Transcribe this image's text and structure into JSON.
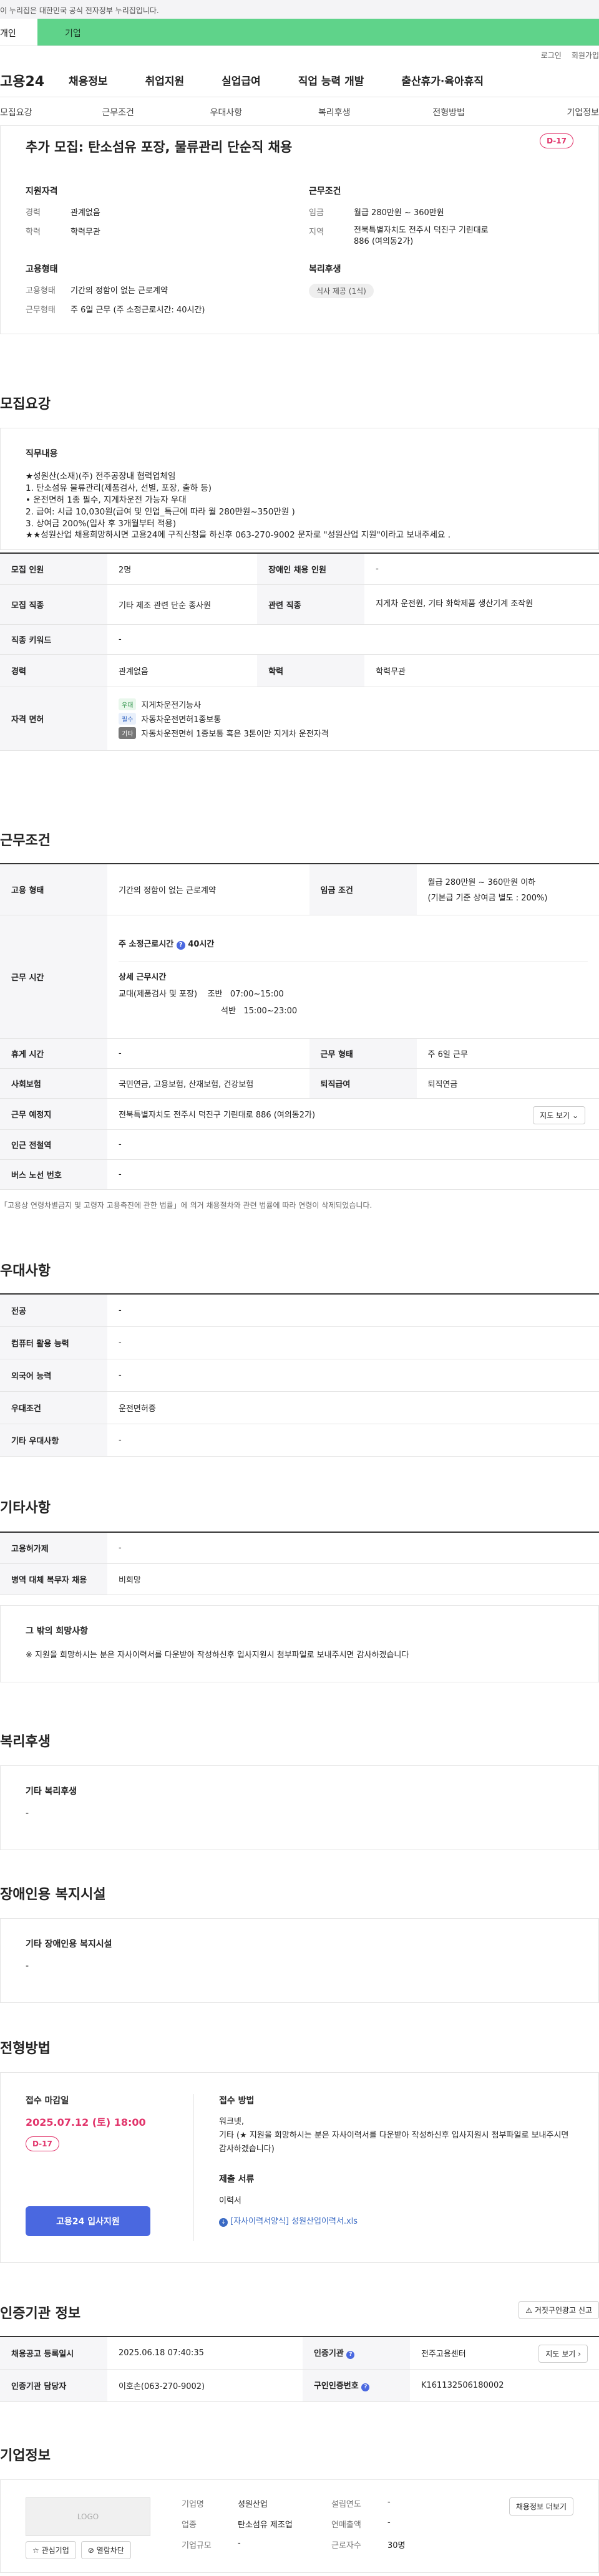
{
  "gov_notice": "이 누리집은 대한민국 공식 전자정부 누리집입니다.",
  "roles": {
    "personal": "개인",
    "company": "기업"
  },
  "util": {
    "login": "로그인",
    "join": "회원가입"
  },
  "gnb": {
    "logo": "고용24",
    "menu": [
      "채용정보",
      "취업지원",
      "실업급여",
      "직업 능력 개발",
      "출산휴가·육아휴직"
    ]
  },
  "tabs": [
    "모집요강",
    "근무조건",
    "우대사항",
    "복리후생",
    "전형방법",
    "기업정보"
  ],
  "head": {
    "title": "추가 모집: 탄소섬유 포장, 물류관리 단순직 채용",
    "dday": "D-17",
    "qual_title": "지원자격",
    "career_k": "경력",
    "career_v": "관계없음",
    "edu_k": "학력",
    "edu_v": "학력무관",
    "cond_title": "근무조건",
    "wage_k": "임금",
    "wage_v": "월급 280만원 ~ 360만원",
    "region_k": "지역",
    "region_v": "전북특별자치도 전주시 덕진구 기린대로 886 (여의동2가)",
    "emp_title": "고용형태",
    "emptype_k": "고용형태",
    "emptype_v": "기간의 정함이 없는 근로계약",
    "worksys_k": "근무형태",
    "worksys_v": "주 6일 근무 (주 소정근로시간: 40시간)",
    "welfare_title": "복리후생",
    "welfare_chip": "식사 제공 (1식)"
  },
  "recruit": {
    "title": "모집요강",
    "duty_title": "직무내용",
    "duty_text": "★성원산(소재)(주) 전주공장내 협력업체임\n1. 탄소섬유  물류관리(제품검사, 선별, 포장, 출하 등)\n• 운전면허 1종 필수,  지게차운전 가능자 우대\n2. 급여: 시급 10,030원(급여 및 인업_특근에 따라 월 280만원~350만원 )\n3. 상여금 200%(입사 후 3개월부터 적용)\n★★성원산업 채용희망하시면 고용24에 구직신청을 하신후   063-270-9002 문자로 \"성원산업 지원\"이라고 보내주세요 .",
    "rows": [
      {
        "k1": "모집 인원",
        "v1": "2명",
        "k2": "장애인 채용 인원",
        "v2": "-"
      },
      {
        "k1": "모집 직종",
        "v1": "기타 제조 관련 단순 종사원",
        "k2": "관련 직종",
        "v2": "지게차 운전원, 기타 화학제품 생산기계 조작원"
      },
      {
        "k1": "직종 키워드",
        "v1": "-"
      },
      {
        "k1": "경력",
        "v1": "관계없음",
        "k2": "학력",
        "v2": "학력무관"
      }
    ],
    "lic_k": "자격 면허",
    "lics": [
      {
        "tag": "우대",
        "name": "지게차운전기능사"
      },
      {
        "tag": "필수",
        "name": "자동차운전면허1종보통"
      },
      {
        "tag": "기타",
        "name": "자동차운전면허 1종보통 혹은 3톤이만 지게차 운전자격"
      }
    ]
  },
  "cond": {
    "title": "근무조건",
    "emp_k": "고용 형태",
    "emp_v": "기간의 정함이 없는 근로계약",
    "wage_k": "임금 조건",
    "wage_v": "월급 280만원 ~ 360만원 이하",
    "wage_sub": "(기본급 기준 상여금 별도 : 200%)",
    "time_k": "근무 시간",
    "std_hours": "주 소정근로시간",
    "std_hours_v": "40시간",
    "detail_title": "상세 근무시간",
    "detail_type": "교대(제품검사 및 포장)",
    "shift1_k": "조반",
    "shift1_v": "07:00~15:00",
    "shift2_k": "석반",
    "shift2_v": "15:00~23:00",
    "rest_k": "휴게 시간",
    "rest_v": "-",
    "form_k": "근무 형태",
    "form_v": "주 6일 근무",
    "ins_k": "사회보험",
    "ins_v": "국민연금, 고용보험, 산재보험, 건강보험",
    "ret_k": "퇴직급여",
    "ret_v": "퇴직연금",
    "loc_k": "근무 예정지",
    "loc_v": "전북특별자치도 전주시 덕진구 기린대로 886 (여의동2가)",
    "map_btn": "지도 보기",
    "station_k": "인근 전철역",
    "station_v": "-",
    "bus_k": "버스 노선 번호",
    "bus_v": "-",
    "footnote": "「고용상 연령차별금지 및 고령자 고용촉진에 관한 법률」에 의거 채용절차와 관련 법률에 따라 연령이 삭제되었습니다."
  },
  "pref": {
    "title": "우대사항",
    "rows": [
      {
        "k": "전공",
        "v": "-"
      },
      {
        "k": "컴퓨터 활용 능력",
        "v": "-"
      },
      {
        "k": "외국어 능력",
        "v": "-"
      },
      {
        "k": "우대조건",
        "v": "운전면허증"
      },
      {
        "k": "기타 우대사항",
        "v": "-"
      }
    ]
  },
  "etc": {
    "title": "기타사항",
    "rows": [
      {
        "k": "고용허가제",
        "v": "-"
      },
      {
        "k": "병역 대체 복무자 채용",
        "v": "비희망"
      }
    ],
    "other_title": "그 밖의 희망사항",
    "other_text": "※ 지원을 희망하시는 분은 자사이력서를 다운받아 작성하신후 입사지원시 첨부파일로 보내주시면 감사하겠습니다"
  },
  "welfare": {
    "title": "복리후생",
    "sub": "기타 복리후생",
    "v": "-"
  },
  "disab": {
    "title": "장애인용 복지시설",
    "sub": "기타 장애인용 복지시설",
    "v": "-"
  },
  "method": {
    "title": "전형방법",
    "deadline_title": "접수 마감일",
    "deadline": "2025.07.12 (토) 18:00",
    "dday": "D-17",
    "apply_btn": "고용24 입사지원",
    "how_title": "접수 방법",
    "how_text": "워크넷,\n기타 (★ 지원을 희망하시는 분은 자사이력서를 다운받아 작성하신후 입사지원시 첨부파일로 보내주시면 감사하겠습니다)",
    "docs_title": "제출 서류",
    "docs_v": "이력서",
    "file": "[자사이력서양식] 성원산업이력서.xls"
  },
  "agency": {
    "title": "인증기관 정보",
    "report_btn": "거짓구인광고 신고",
    "reg_k": "채용공고 등록일시",
    "reg_v": "2025.06.18 07:40:35",
    "org_k": "인증기관",
    "org_v": "전주고용센터",
    "more_btn": "지도 보기",
    "mgr_k": "인증기관 담당자",
    "mgr_v": "이호손(063-270-9002)",
    "no_k": "구인인증번호",
    "no_v": "K161132506180002"
  },
  "company": {
    "title": "기업정보",
    "logo": "LOGO",
    "fav_btn": "관심기업",
    "block_btn": "열람차단",
    "name_k": "기업명",
    "name_v": "성원산업",
    "ind_k": "업종",
    "ind_v": "탄소섬유 제조업",
    "size_k": "기업규모",
    "size_v": "-",
    "est_k": "설립연도",
    "est_v": "-",
    "sales_k": "연매출액",
    "sales_v": "-",
    "emp_k": "근로자수",
    "emp_v": "30명",
    "list_btn": "채용정보 더보기"
  }
}
